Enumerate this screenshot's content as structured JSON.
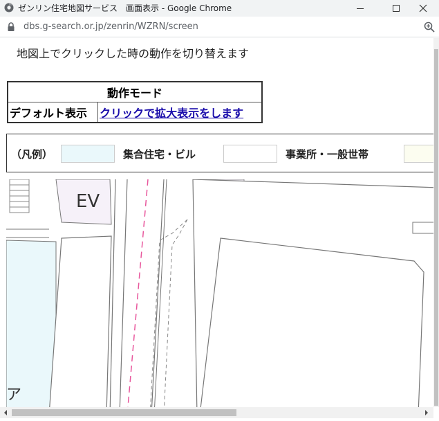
{
  "window": {
    "title": "ゼンリン住宅地図サービス　画面表示 - Google Chrome",
    "app_icon": "chrome-app-icon",
    "controls": [
      "minimize-icon",
      "maximize-icon",
      "close-icon"
    ]
  },
  "address_bar": {
    "url": "dbs.g-search.or.jp/zenrin/WZRN/screen",
    "left_icon": "lock-icon",
    "right_icon": "zoom-icon"
  },
  "page": {
    "instruction": "地図上でクリックした時の動作を切り替えます",
    "mode_table": {
      "header": "動作モード",
      "row_label": "デフォルト表示",
      "row_link": "クリックで拡大表示をします"
    },
    "legend": {
      "label": "（凡例）",
      "items": [
        {
          "label": "集合住宅・ビル",
          "color": "#eaf8fb"
        },
        {
          "label": "事業所・一般世帯",
          "color": "#ffffff"
        },
        {
          "label": "",
          "color": "#fcfdf0"
        }
      ]
    },
    "map": {
      "labels": [
        "EV",
        "ア"
      ],
      "colors": {
        "apartment": "#eaf8fb",
        "elevator": "#f6f1f9",
        "line": "#777777",
        "boundary": "#e8569c"
      }
    }
  }
}
